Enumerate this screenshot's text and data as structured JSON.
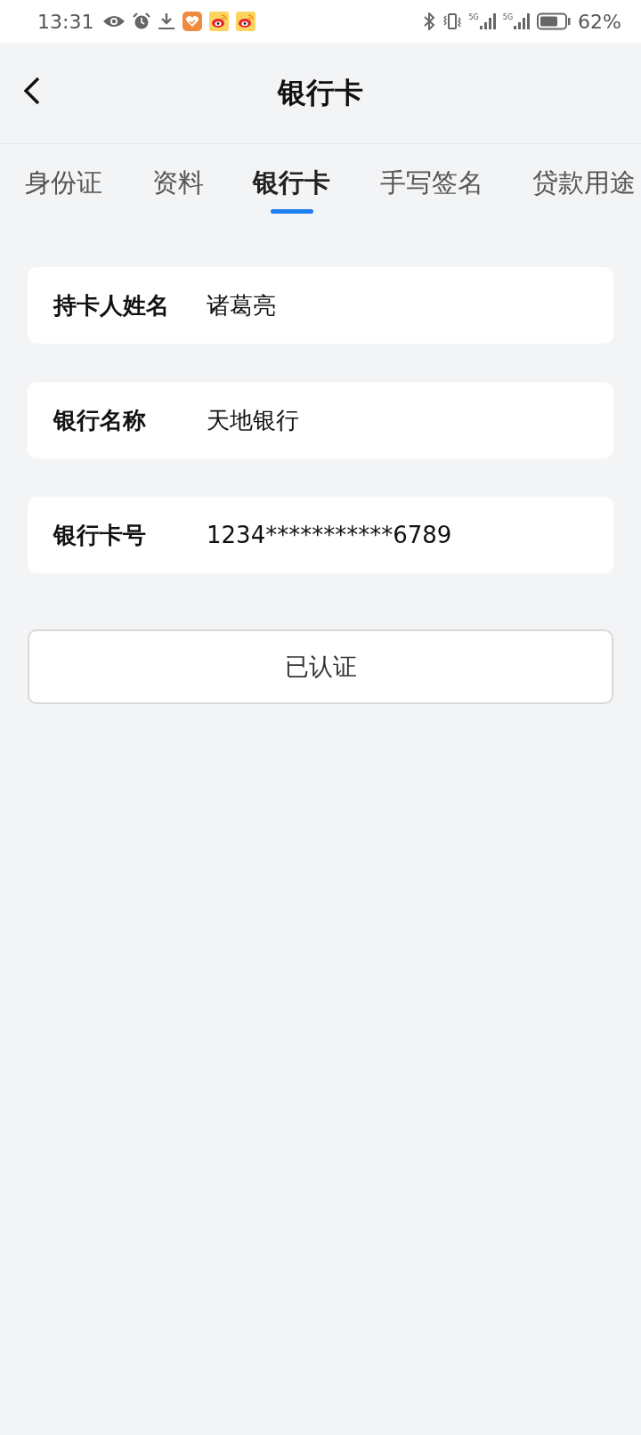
{
  "status_bar": {
    "time": "13:31",
    "signals": [
      {
        "label": "5G"
      },
      {
        "label": "5G"
      }
    ],
    "battery": "62%"
  },
  "header": {
    "title": "银行卡"
  },
  "tabs": [
    {
      "label": "身份证",
      "selected": false
    },
    {
      "label": "资料",
      "selected": false
    },
    {
      "label": "银行卡",
      "selected": true
    },
    {
      "label": "手写签名",
      "selected": false
    },
    {
      "label": "贷款用途",
      "selected": false
    }
  ],
  "fields": [
    {
      "label": "持卡人姓名",
      "value": "诸葛亮"
    },
    {
      "label": "银行名称",
      "value": "天地银行"
    },
    {
      "label": "银行卡号",
      "value": "1234***********6789"
    }
  ],
  "button": "已认证"
}
